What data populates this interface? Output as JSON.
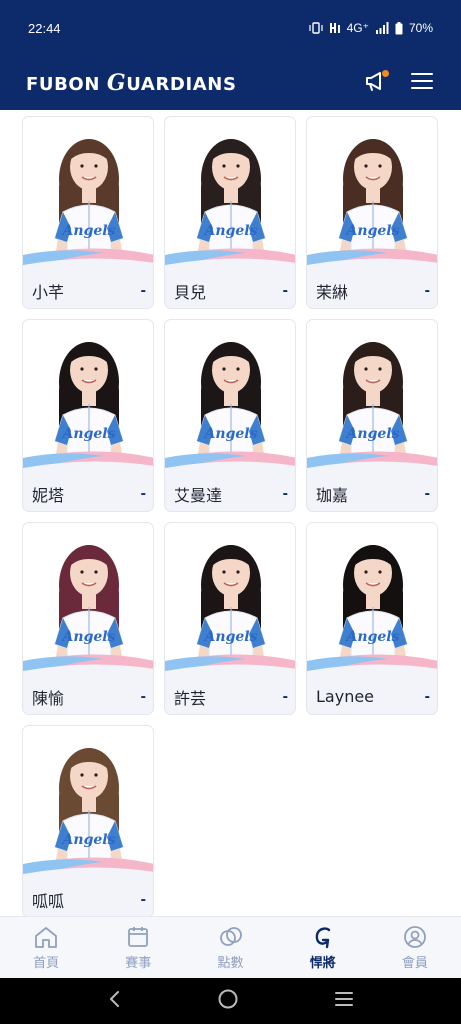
{
  "status_bar": {
    "time": "22:44",
    "network": "4G⁺",
    "battery": "70%"
  },
  "header": {
    "logo_prefix": "FUBON ",
    "logo_g": "G",
    "logo_suffix": "UARDIANS",
    "announcement_icon": "megaphone-icon",
    "menu_icon": "hamburger-menu-icon"
  },
  "members": [
    {
      "name": "小芊",
      "number": "-"
    },
    {
      "name": "貝兒",
      "number": "-"
    },
    {
      "name": "茉綝",
      "number": "-"
    },
    {
      "name": "妮塔",
      "number": "-"
    },
    {
      "name": "艾曼達",
      "number": "-"
    },
    {
      "name": "珈嘉",
      "number": "-"
    },
    {
      "name": "陳愉",
      "number": "-"
    },
    {
      "name": "許芸",
      "number": "-"
    },
    {
      "name": "Laynee",
      "number": "-"
    },
    {
      "name": "呱呱",
      "number": "-"
    }
  ],
  "bottom_nav": {
    "items": [
      {
        "label": "首頁",
        "icon": "home-icon"
      },
      {
        "label": "賽事",
        "icon": "calendar-icon"
      },
      {
        "label": "點數",
        "icon": "points-icon"
      },
      {
        "label": "悍將",
        "icon": "guardians-g-icon"
      },
      {
        "label": "會員",
        "icon": "user-icon"
      }
    ],
    "active_index": 3
  },
  "colors": {
    "brand_navy": "#0d2a6b",
    "nav_inactive": "#8fa0c0",
    "accent_orange": "#f08a24",
    "wave_blue": "#8ec3f2",
    "wave_pink": "#f4b6c8"
  }
}
